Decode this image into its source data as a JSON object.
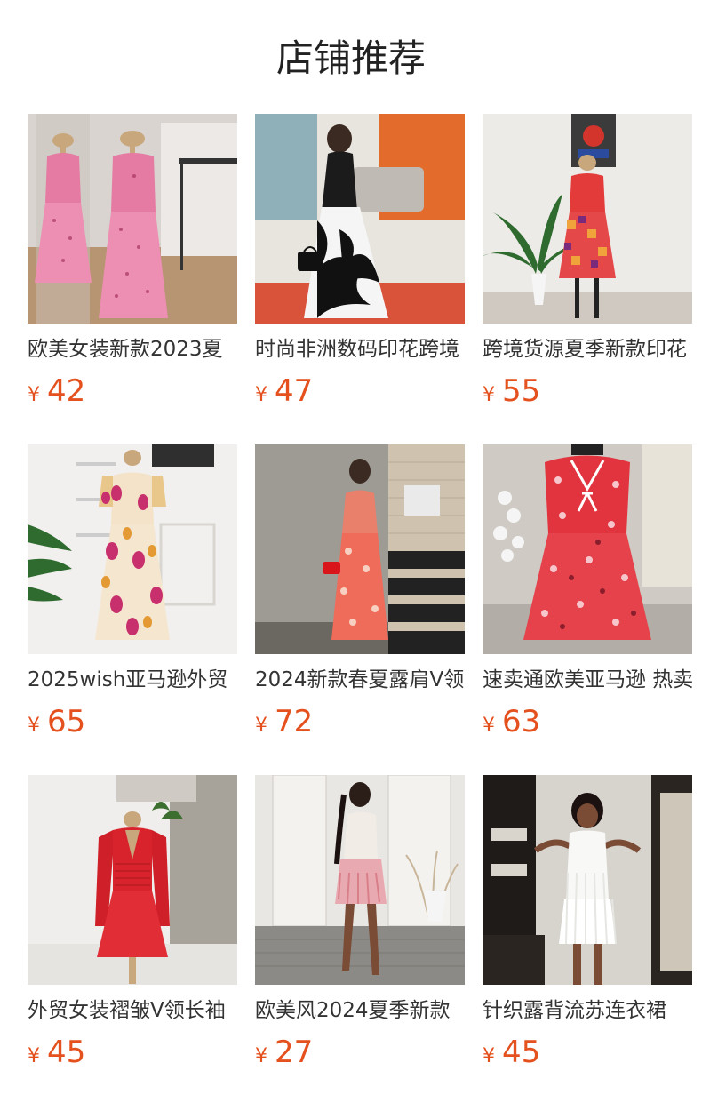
{
  "header": {
    "title": "店铺推荐"
  },
  "currency_symbol": "¥",
  "accent_color": "#e4511e",
  "products": [
    {
      "name": "欧美女装新款2023夏",
      "price": "42",
      "image": "pink-floral-dresses-on-mannequins"
    },
    {
      "name": "时尚非洲数码印花跨境",
      "price": "47",
      "image": "black-white-print-halter-dress"
    },
    {
      "name": "跨境货源夏季新款印花",
      "price": "55",
      "image": "red-geometric-print-dress-on-mannequin"
    },
    {
      "name": "2025wish亚马逊外贸",
      "price": "65",
      "image": "pink-floral-puff-sleeve-dress-on-mannequin"
    },
    {
      "name": "2024新款春夏露肩V领",
      "price": "72",
      "image": "red-floral-maxi-dress-on-stairs"
    },
    {
      "name": "速卖通欧美亚马逊 热卖",
      "price": "63",
      "image": "red-floral-tie-front-dress-on-mannequin"
    },
    {
      "name": "外贸女装褶皱V领长袖",
      "price": "45",
      "image": "red-v-neck-long-sleeve-dress"
    },
    {
      "name": "欧美风2024夏季新款",
      "price": "27",
      "image": "pink-feather-mini-skirt-outfit"
    },
    {
      "name": "针织露背流苏连衣裙",
      "price": "45",
      "image": "white-fringe-knit-mini-dress"
    }
  ]
}
